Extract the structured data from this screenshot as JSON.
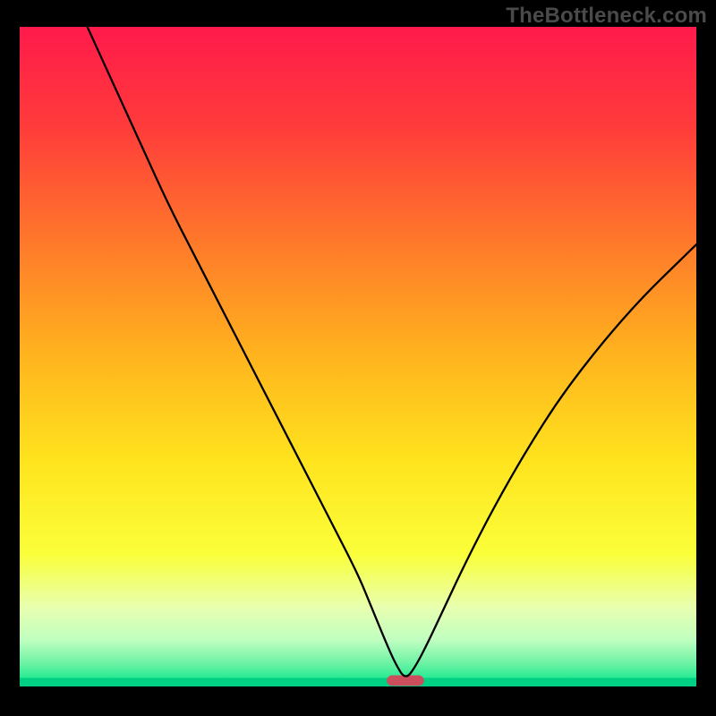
{
  "attribution": "TheBottleneck.com",
  "chart_data": {
    "type": "line",
    "title": "",
    "xlabel": "",
    "ylabel": "",
    "xlim": [
      0,
      100
    ],
    "ylim": [
      0,
      100
    ],
    "grid": false,
    "legend": false,
    "background_gradient_stops": [
      {
        "offset": 0.0,
        "color": "#ff1a4b"
      },
      {
        "offset": 0.15,
        "color": "#ff3b3b"
      },
      {
        "offset": 0.33,
        "color": "#ff7a2a"
      },
      {
        "offset": 0.5,
        "color": "#ffb41e"
      },
      {
        "offset": 0.66,
        "color": "#ffe41e"
      },
      {
        "offset": 0.8,
        "color": "#faff3a"
      },
      {
        "offset": 0.88,
        "color": "#e8ffb0"
      },
      {
        "offset": 0.93,
        "color": "#bfffc0"
      },
      {
        "offset": 0.965,
        "color": "#6cf2a4"
      },
      {
        "offset": 1.0,
        "color": "#00e68a"
      }
    ],
    "bottom_band": {
      "y_from": 98.7,
      "y_to": 100,
      "color": "#00d084"
    },
    "marker": {
      "x": 57,
      "y": 99.1,
      "width_pct": 5.5,
      "height_pct": 1.6,
      "fill": "#cc4e5c",
      "rx_pct": 0.8
    },
    "series": [
      {
        "name": "curve",
        "stroke": "#000000",
        "stroke_width": 2.3,
        "x": [
          10.0,
          14.0,
          18.0,
          22.0,
          26.0,
          30.0,
          34.0,
          38.0,
          42.0,
          46.0,
          50.0,
          52.0,
          54.0,
          55.5,
          57.0,
          58.5,
          60.5,
          63.0,
          66.0,
          70.0,
          75.0,
          80.0,
          86.0,
          92.0,
          98.0,
          100.0
        ],
        "y": [
          0.0,
          9.0,
          18.0,
          27.0,
          35.0,
          43.0,
          51.0,
          59.0,
          67.0,
          75.0,
          83.0,
          88.0,
          93.0,
          96.5,
          99.0,
          97.0,
          93.0,
          87.5,
          81.0,
          73.0,
          64.0,
          56.0,
          48.0,
          41.0,
          35.0,
          33.0
        ]
      }
    ]
  }
}
